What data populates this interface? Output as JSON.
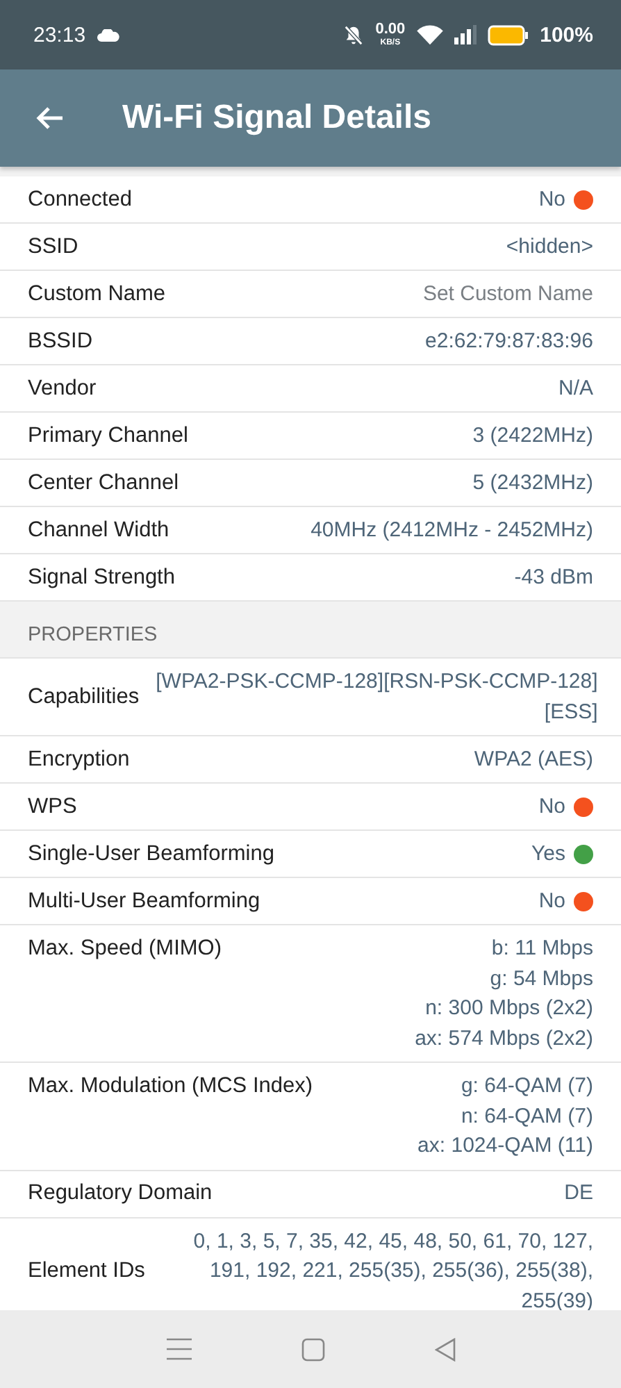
{
  "status_bar": {
    "time": "23:13",
    "speed": "0.00",
    "speed_unit": "KB/S",
    "battery": "100%"
  },
  "app_bar": {
    "title": "Wi-Fi Signal Details"
  },
  "sections": [
    {
      "rows": [
        {
          "kind": "single",
          "label": "Connected",
          "lines": [
            "No"
          ],
          "color": "#f4511e"
        },
        {
          "kind": "single",
          "label": "SSID",
          "lines": [
            "<hidden>"
          ]
        },
        {
          "kind": "single",
          "label": "Custom Name",
          "lines": [
            "Set Custom Name"
          ],
          "placeholder": true
        },
        {
          "kind": "single",
          "label": "BSSID",
          "lines": [
            "e2:62:79:87:83:96"
          ]
        },
        {
          "kind": "single",
          "label": "Vendor",
          "lines": [
            "N/A"
          ]
        },
        {
          "kind": "single",
          "label": "Primary Channel",
          "lines": [
            "3 (2422MHz)"
          ]
        },
        {
          "kind": "single",
          "label": "Center Channel",
          "lines": [
            "5 (2432MHz)"
          ]
        },
        {
          "kind": "single",
          "label": "Channel Width",
          "lines": [
            "40MHz (2412MHz - 2452MHz)"
          ]
        },
        {
          "kind": "single",
          "label": "Signal Strength",
          "lines": [
            "-43 dBm"
          ]
        }
      ]
    },
    {
      "header": "PROPERTIES",
      "rows": [
        {
          "kind": "wrapped",
          "label": "Capabilities",
          "lines": [
            "[WPA2-PSK-CCMP-128][RSN-PSK-CCMP-128]",
            "[ESS]"
          ]
        },
        {
          "kind": "single",
          "label": "Encryption",
          "lines": [
            "WPA2 (AES)"
          ]
        },
        {
          "kind": "single",
          "label": "WPS",
          "lines": [
            "No"
          ],
          "color": "#f4511e"
        },
        {
          "kind": "single",
          "label": "Single-User Beamforming",
          "lines": [
            "Yes"
          ],
          "color": "#43a047"
        },
        {
          "kind": "single",
          "label": "Multi-User Beamforming",
          "lines": [
            "No"
          ],
          "color": "#f4511e"
        },
        {
          "kind": "list",
          "label": "Max. Speed (MIMO)",
          "lines": [
            "b: 11 Mbps",
            "g: 54 Mbps",
            "n: 300 Mbps (2x2)",
            "ax: 574 Mbps (2x2)"
          ]
        },
        {
          "kind": "list",
          "label": "Max. Modulation (MCS Index)",
          "lines": [
            "g: 64-QAM (7)",
            "n: 64-QAM (7)",
            "ax: 1024-QAM (11)"
          ]
        },
        {
          "kind": "single",
          "label": "Regulatory Domain",
          "lines": [
            "DE"
          ]
        },
        {
          "kind": "wrapped",
          "label": "Element IDs",
          "lines": [
            "0, 1, 3, 5, 7, 35, 42, 45, 48, 50, 61, 70, 127,",
            "191, 192, 221, 255(35), 255(36), 255(38),",
            "255(39)"
          ]
        }
      ]
    }
  ]
}
